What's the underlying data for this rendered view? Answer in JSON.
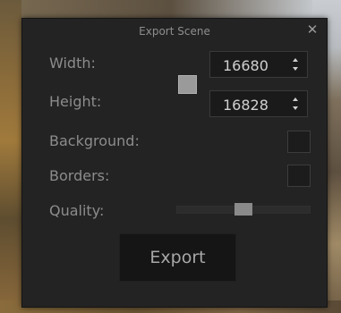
{
  "dialog": {
    "title": "Export Scene",
    "close_icon": "close-icon",
    "width": {
      "label": "Width:",
      "value": "16680"
    },
    "height": {
      "label": "Height:",
      "value": "16828"
    },
    "background": {
      "label": "Background:",
      "checked": false
    },
    "borders": {
      "label": "Borders:",
      "checked": false
    },
    "quality": {
      "label": "Quality:",
      "level_fraction": 0.5
    },
    "export_label": "Export",
    "swatch_color": "#9a9a9a"
  },
  "colors": {
    "dialog_bg": "#232323",
    "text": "#8c8c8c",
    "value_text": "#d0d0d0"
  }
}
